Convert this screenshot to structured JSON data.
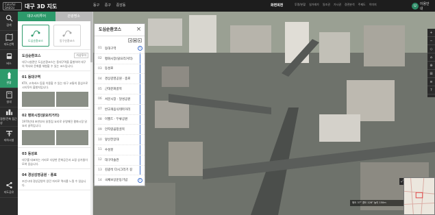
{
  "logo": "Colorful DAEGU",
  "app_title": "대구 3D 지도",
  "location": [
    "동구",
    "중구",
    "중앙동"
  ],
  "wide_label": "화면회전",
  "toolbar": [
    "투명/분할",
    "실거래가",
    "일조권",
    "가시권",
    "경관분석",
    "주제도",
    "이미지"
  ],
  "user": {
    "initial": "U",
    "label": "이용안내"
  },
  "nav": [
    {
      "label": "검색",
      "icon": "search-icon"
    },
    {
      "label": "지도선택",
      "icon": "map-icon"
    },
    {
      "label": "버스",
      "icon": "bus-icon"
    },
    {
      "label": "관광",
      "icon": "tower-icon"
    },
    {
      "label": "실내",
      "icon": "building-icon"
    },
    {
      "label": "경관/건축 접근성",
      "icon": "city-icon"
    },
    {
      "label": "지하시설",
      "icon": "tunnel-icon"
    },
    {
      "label": "지도공유",
      "icon": "share-icon"
    }
  ],
  "panel": {
    "tabs": [
      "대구시티투어",
      "관광명소"
    ],
    "categories": [
      {
        "label": "도심순환코스"
      },
      {
        "label": "동구순환코스"
      }
    ],
    "sections": [
      {
        "title": "도심순환코스",
        "btn": "가상투어",
        "text": "대구시설관인 도심순환코스는 동대구역을 출발하여 대구의 역사와 문화를 체험할 수 있는 코스입니다."
      },
      {
        "title": "01 동대구역",
        "btn": "",
        "text": "KTX, 고속버스 등을 이용할 수 있는 대구 교통의 중심으로 시티투어 출발지입니다."
      },
      {
        "title": "02 평화시장(닭요리거리)",
        "btn": "",
        "text": "1970년대 초반부터 닭똥집 요리로 유명해진 평화시장 닭요리 골목입니다."
      },
      {
        "title": "03 동성로",
        "btn": "",
        "text": "대구를 대표하는 거리로 다양한 문화공간과 쇼핑 상가들이 모여 있습니다."
      },
      {
        "title": "04 경상감영공원 · 종로",
        "btn": "",
        "text": "조선시대 경상감영이 있던 자리로 역사를 느낄 수 있습니다."
      }
    ]
  },
  "course": {
    "title": "도심순환코스",
    "controls": [
      "◀",
      "■",
      "▶"
    ],
    "items": [
      {
        "no": "01",
        "name": "동대구역",
        "mark": "S"
      },
      {
        "no": "02",
        "name": "평화시장(닭요리거리)",
        "mark": ""
      },
      {
        "no": "03",
        "name": "동성로",
        "mark": ""
      },
      {
        "no": "04",
        "name": "경상감영공원 · 종로",
        "mark": ""
      },
      {
        "no": "05",
        "name": "근대문화골목",
        "mark": ""
      },
      {
        "no": "06",
        "name": "서문시장 · 달성공원",
        "mark": ""
      },
      {
        "no": "07",
        "name": "반고개음식테마거리",
        "mark": ""
      },
      {
        "no": "08",
        "name": "이월드 · 두류공원",
        "mark": ""
      },
      {
        "no": "09",
        "name": "안지랑곱창골목",
        "mark": ""
      },
      {
        "no": "10",
        "name": "앞산전망대",
        "mark": ""
      },
      {
        "no": "11",
        "name": "수성못",
        "mark": ""
      },
      {
        "no": "12",
        "name": "대구미술관",
        "mark": ""
      },
      {
        "no": "13",
        "name": "김광석 다시그리기 길",
        "mark": ""
      },
      {
        "no": "14",
        "name": "국채보상운동기념",
        "mark": "E"
      }
    ]
  },
  "right_tools": [
    "+",
    "−",
    "◇",
    "⌂",
    "⊕",
    "⊞",
    "≡",
    "?"
  ],
  "status": "위도 37° 경도 128° 높이 150m",
  "minimap_btn": "⤢"
}
